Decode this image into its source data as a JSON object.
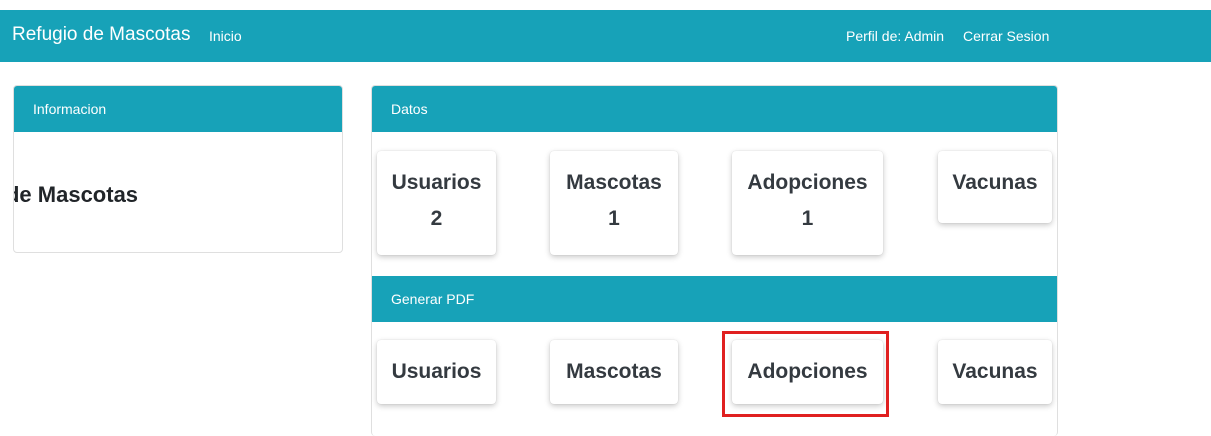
{
  "navbar": {
    "brand": "Refugio de Mascotas",
    "home": "Inicio",
    "profile": "Perfil de: Admin",
    "logout": "Cerrar Sesion"
  },
  "info": {
    "header": "Informacion",
    "text": "Refugio de Mascotas"
  },
  "datos": {
    "header": "Datos",
    "stats": [
      {
        "label": "Usuarios",
        "value": "2"
      },
      {
        "label": "Mascotas",
        "value": "1"
      },
      {
        "label": "Adopciones",
        "value": "1"
      },
      {
        "label": "Vacunas",
        "value": ""
      }
    ]
  },
  "pdf": {
    "header": "Generar PDF",
    "buttons": [
      "Usuarios",
      "Mascotas",
      "Adopciones",
      "Vacunas"
    ]
  },
  "colors": {
    "primary": "#17a2b8",
    "highlight": "#e02020"
  }
}
